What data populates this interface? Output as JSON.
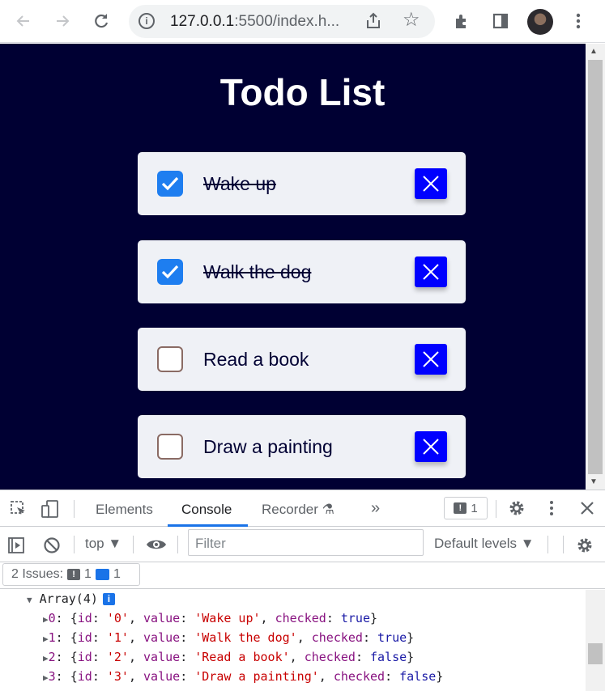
{
  "browser": {
    "url_host": "127.0.0.1",
    "url_rest": ":5500/index.h...",
    "icons": [
      "back-icon",
      "forward-icon",
      "reload-icon",
      "site-info-icon",
      "share-icon",
      "star-icon",
      "extensions-icon",
      "side-panel-icon",
      "menu-icon"
    ]
  },
  "page": {
    "title": "Todo List",
    "colors": {
      "background": "#000033",
      "card": "#eff1f6",
      "checkbox_checked": "#1e7ef0",
      "delete_button": "#0000ff"
    },
    "todos": [
      {
        "label": "Wake up",
        "checked": true
      },
      {
        "label": "Walk the dog",
        "checked": true
      },
      {
        "label": "Read a book",
        "checked": false
      },
      {
        "label": "Draw a painting",
        "checked": false
      }
    ]
  },
  "devtools": {
    "tabs": [
      "Elements",
      "Console",
      "Recorder"
    ],
    "active_tab": "Console",
    "more_tabs": "»",
    "issue_count_badge": "1",
    "context": "top",
    "filter_placeholder": "Filter",
    "levels": "Default levels",
    "issues": {
      "label": "2 Issues:",
      "error_count": "1",
      "info_count": "1"
    },
    "console": {
      "array_header": "Array(4)",
      "rows": [
        {
          "index": "0",
          "id": "'0'",
          "value": "'Wake up'",
          "checked": "true"
        },
        {
          "index": "1",
          "id": "'1'",
          "value": "'Walk the dog'",
          "checked": "true"
        },
        {
          "index": "2",
          "id": "'2'",
          "value": "'Read a book'",
          "checked": "false"
        },
        {
          "index": "3",
          "id": "'3'",
          "value": "'Draw a painting'",
          "checked": "false"
        }
      ]
    }
  }
}
